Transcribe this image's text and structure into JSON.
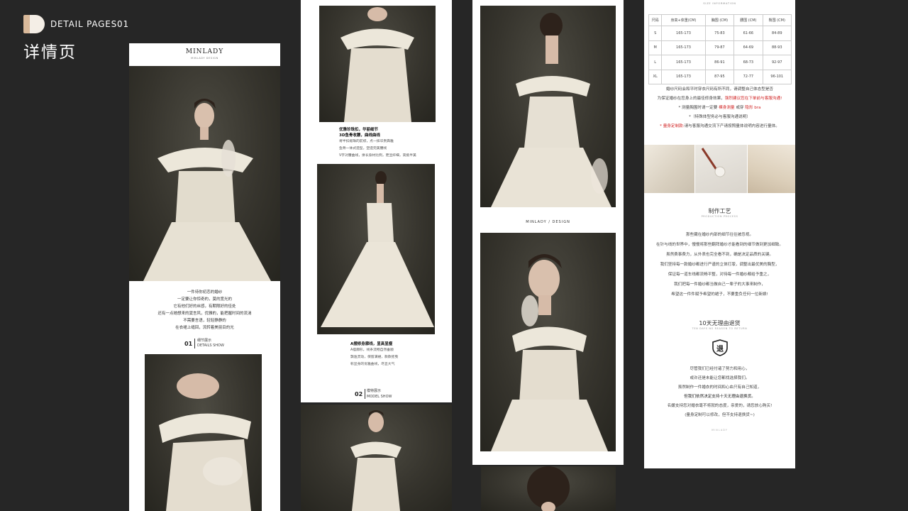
{
  "header": {
    "brand": "DETAIL PAGES01",
    "title_cn": "详情页"
  },
  "col1": {
    "brand_name": "MINLADY",
    "brand_sub": "MINLADY DESIGN",
    "poem": [
      "一件待你初恋的婚纱",
      "一定要让你惊奇的，莫的宽光的",
      "它有他们好的丝感，有期限好的佳处",
      "还有一点她想来的窦言风，优雅的，能把握时间的流淌",
      "不需要言语，轻轻静静的",
      "在衣裙上缝回，流转着美丽目的光"
    ],
    "section_no": "01",
    "section_cn": "细节展示",
    "section_en": "DETAILS SHOW"
  },
  "col2": {
    "caption1_title": [
      "优雅珍珠扣，华丽细节",
      "3D鱼骨收腰，曲线曲线"
    ],
    "caption1_lines": [
      "将半扣缀珠的前襟，点一抹华贵典雅",
      "鱼骨一体式造型，塑造完美腰线",
      "V字对腰曲线，拼长身材比例，更显纤细，高挑半美"
    ],
    "caption2_title": "A摆修身廓线，显高显瘦",
    "caption2_lines": [
      "A摆廓形，线条流畅自然垂顺",
      "飘逸灵动，保留满裙，款款摇曳",
      "彰显身的优雅曲线，尽显大气"
    ],
    "section_no": "02",
    "section_cn": "模特展示",
    "section_en": "MODEL SHOW"
  },
  "col3": {
    "divider": "MINLADY / DESIGN"
  },
  "col4": {
    "size_title": "SIZE INFORMATION",
    "size_table": {
      "headers": [
        "尺码",
        "身高+体重(CM)",
        "胸围 (CM)",
        "腰围 (CM)",
        "臀围 (CM)"
      ],
      "rows": [
        [
          "S",
          "165-173",
          "75-83",
          "61-66",
          "84-89"
        ],
        [
          "M",
          "165-173",
          "79-87",
          "64-69",
          "88-93"
        ],
        [
          "L",
          "165-173",
          "86-91",
          "68-73",
          "92-97"
        ],
        [
          "XL",
          "165-173",
          "87-95",
          "72-77",
          "96-101"
        ]
      ]
    },
    "notes": [
      "婚纱尺码会和平时穿衣尺码有所不同，请调整自己体态型是否",
      "为保证婚纱在您身上的最佳修身效果，",
      "强烈建议您在下单前与客服沟通!",
      "* 测量胸围时请一定要",
      "裸身测量",
      "或穿",
      "隐形 bra",
      "*（特殊体型务必与客服沟通说明）",
      "* 量身定制款:",
      "请与客服沟通交流下产请按照量体说明内容进行量体。"
    ],
    "craft_title_cn": "制作工艺",
    "craft_title_en": "PRODUCTION PROCESS",
    "craft_text": [
      "那些藏在婚纱内部的细节往往被忽视。",
      "在针与线的世界中，慢慢将那些翻拜婚纱才能看到的细节做到更加细致。",
      "虽然费事费力，从外表也完全看不到，确是决定品质的关键。",
      "我们坚持每一款婚纱都进行严谨的立体打版，调整出最优美的胸型，",
      "保证每一道车线都流畅平整，对待每一件婚纱都给予重之，",
      "我们把每一件婚纱都当做自己一辈子的大事来制作，",
      "希望这一件件赋予希望的裙子，不要重负任何一位新娘!"
    ],
    "return_title_cn": "10天无理由退货",
    "return_title_en": "TEN DAYS NO REASON TO RETURN",
    "return_icon_char": "退",
    "return_text": [
      "尽管我们已经付诸了努力和用心，",
      "或许还是未能让您都找选择我们。",
      "虽然制作一件婚衣的时间和心血只有自己知道，",
      "但我们依然决定支持十天无理由退换货。",
      "名媛支持您对婚衣毫不将就的态度，亲爱的，请您放心购买!",
      "(量身定制可以修改，但不支持退换货~)"
    ],
    "footer": "MINLADY"
  }
}
